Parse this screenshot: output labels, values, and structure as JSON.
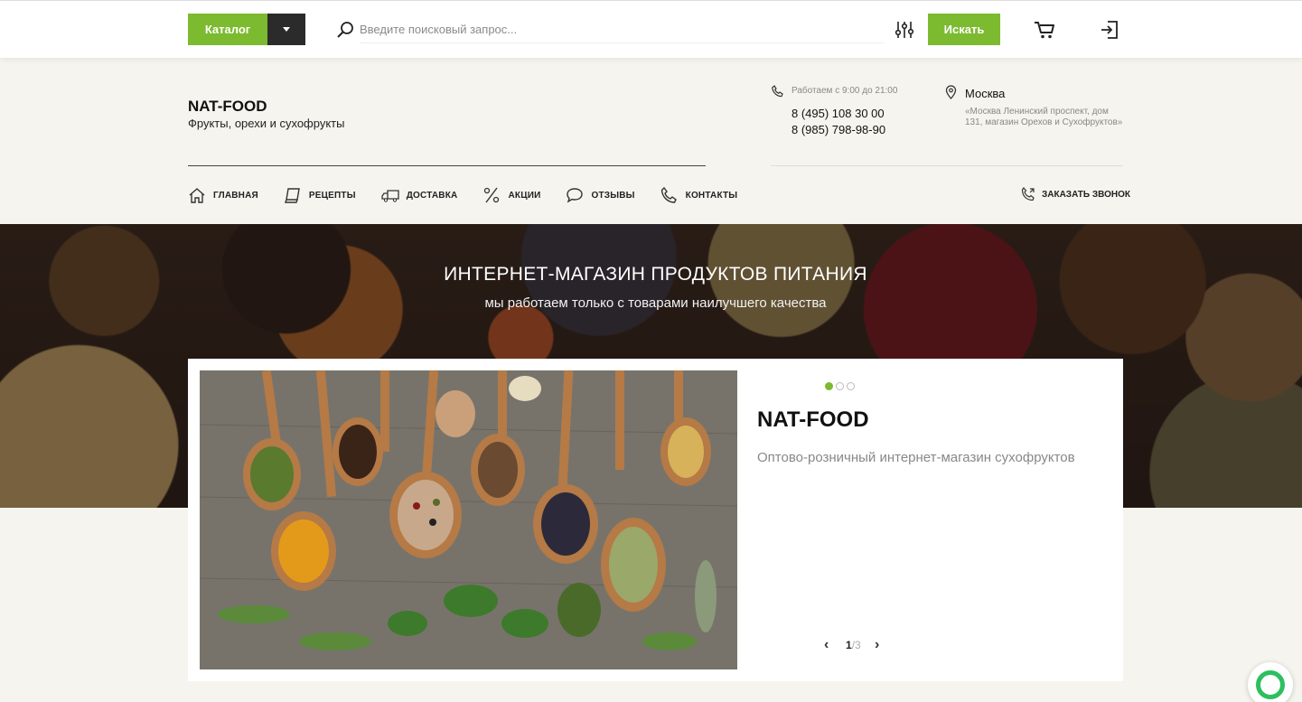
{
  "topbar": {
    "catalog_label": "Каталог",
    "search_placeholder": "Введите поисковый запрос...",
    "search_button": "Искать"
  },
  "header": {
    "brand_name": "NAT-FOOD",
    "brand_sub": "Фрукты, орехи и сухофрукты",
    "work_hours": "Работаем с 9:00 до 21:00",
    "phone1": "8 (495) 108 30 00",
    "phone2": "8 (985) 798-98-90",
    "city": "Москва",
    "address": "«Москва Ленинский проспект, дом 131, магазин Орехов и Сухофруктов»"
  },
  "nav": {
    "items": [
      {
        "label": "ГЛАВНАЯ",
        "icon": "home-icon"
      },
      {
        "label": "РЕЦЕПТЫ",
        "icon": "book-icon"
      },
      {
        "label": "ДОСТАВКА",
        "icon": "truck-icon"
      },
      {
        "label": "АКЦИИ",
        "icon": "percent-icon"
      },
      {
        "label": "ОТЗЫВЫ",
        "icon": "chat-bubble-icon"
      },
      {
        "label": "КОНТАКТЫ",
        "icon": "phone-icon"
      }
    ],
    "callback_label": "ЗАКАЗАТЬ ЗВОНОК"
  },
  "hero": {
    "title": "ИНТЕРНЕТ-МАГАЗИН ПРОДУКТОВ ПИТАНИЯ",
    "subtitle": "мы работаем только с товарами наилучшего качества"
  },
  "slider": {
    "title": "NAT-FOOD",
    "text": "Оптово-розничный интернет-магазин сухофруктов",
    "current": "1",
    "total": "/3",
    "active_dot": 1,
    "dot_count": 3
  },
  "colors": {
    "accent": "#7cba2f",
    "dark": "#2b2b2b",
    "chat": "#2dbf5f"
  }
}
